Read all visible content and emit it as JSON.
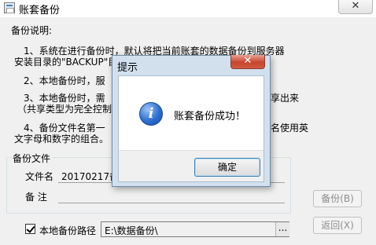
{
  "window": {
    "title": "账套备份",
    "close_symbol": "✕"
  },
  "description": {
    "heading": "备份说明:",
    "line1": "1、系统在进行备份时，默认将把当前账套的数据备份到服务器",
    "line2": "安装目录的\"BACKUP\"目",
    "line3": "2、本地备份时，服",
    "line4": "3、本地备份时，需",
    "line4_tail": "享出来",
    "line5": "（共享类型为完全控制",
    "line6": "4、备份文件名第一",
    "line6_tail": "名使用英",
    "line7": "文字母和数字的组合。"
  },
  "backup_file": {
    "group_title": "备份文件",
    "filename_label": "文件名",
    "filename_value": "20170217备份",
    "note_label": "备  注",
    "note_value": ""
  },
  "local_path": {
    "checkbox_label": "本地备份路径",
    "checked": true,
    "value": "E:\\数据备份\\",
    "browse_label": "..."
  },
  "buttons": {
    "backup": "备份(B)",
    "back": "返回(X)"
  },
  "dialog": {
    "title": "提示",
    "close_symbol": "✕",
    "icon": "info-icon",
    "icon_glyph": "i",
    "message": "账套备份成功！",
    "ok_label": "确定"
  }
}
